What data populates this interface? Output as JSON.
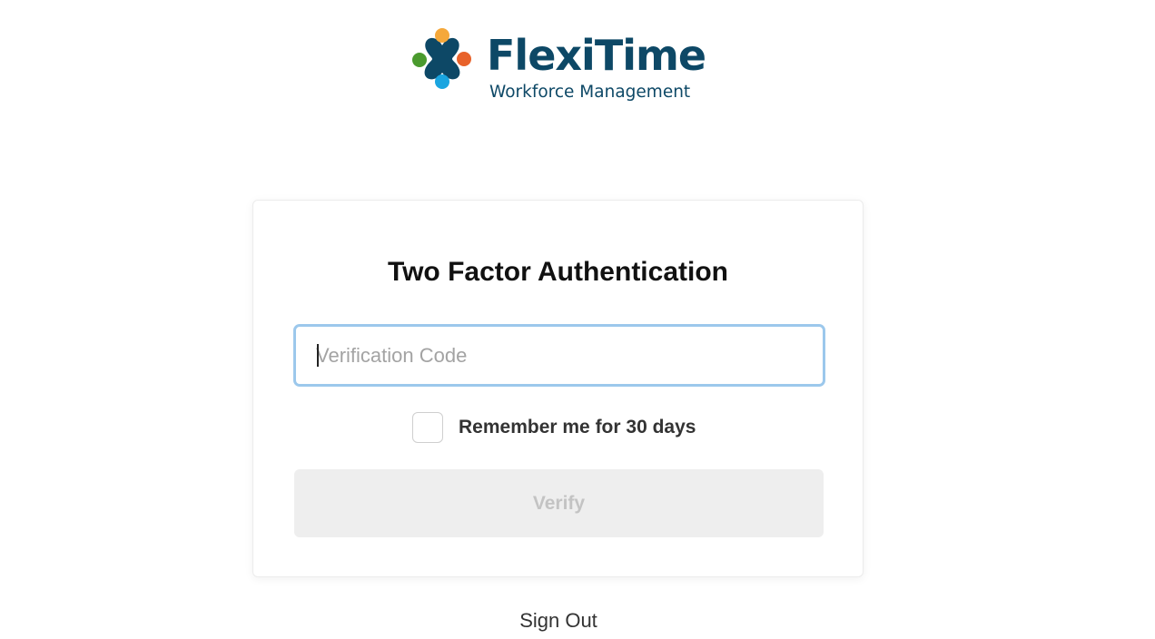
{
  "brand": {
    "name": "FlexiTime",
    "tagline": "Workforce Management",
    "colors": {
      "primary": "#0d4866",
      "dot_top": "#f5a83a",
      "dot_right": "#e8622a",
      "dot_left": "#4a9a2e",
      "dot_bottom": "#1aa5e0"
    }
  },
  "auth": {
    "title": "Two Factor Authentication",
    "code_placeholder": "Verification Code",
    "code_value": "",
    "remember_label": "Remember me for 30 days",
    "remember_checked": false,
    "verify_label": "Verify",
    "verify_enabled": false
  },
  "footer": {
    "sign_out_label": "Sign Out"
  }
}
